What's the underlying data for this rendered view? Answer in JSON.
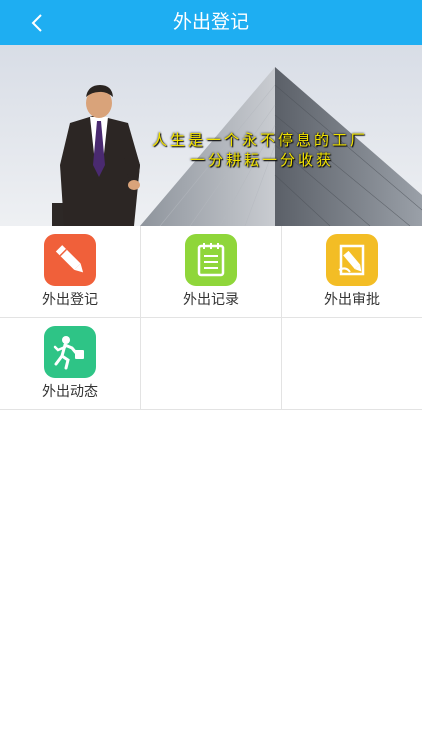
{
  "header": {
    "title": "外出登记",
    "back_icon": "chevron-left-icon",
    "color": "#1eaef2"
  },
  "banner": {
    "line1": "人生是一个永不停息的工厂",
    "line2": "一分耕耘一分收获"
  },
  "menu": {
    "items": [
      {
        "label": "外出登记",
        "icon": "pencil-icon",
        "color": "#f0603a"
      },
      {
        "label": "外出记录",
        "icon": "notepad-icon",
        "color": "#8fd63a"
      },
      {
        "label": "外出审批",
        "icon": "approval-icon",
        "color": "#f3bd25"
      },
      {
        "label": "外出动态",
        "icon": "running-person-icon",
        "color": "#2ec486"
      }
    ]
  }
}
